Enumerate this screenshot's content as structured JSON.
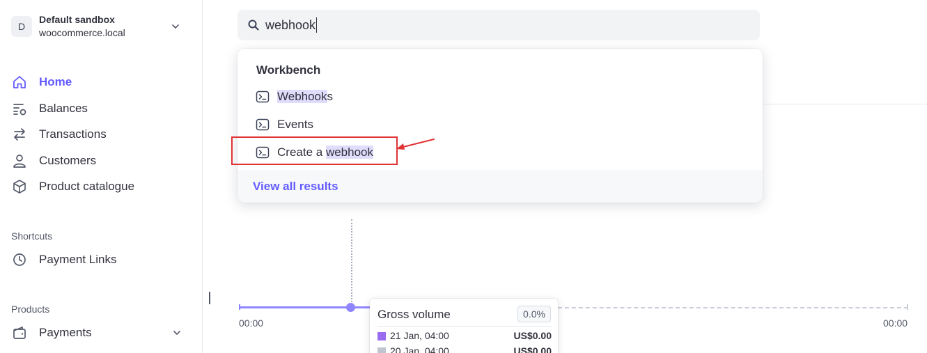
{
  "account": {
    "avatar_letter": "D",
    "name": "Default sandbox",
    "site": "woocommerce.local"
  },
  "nav": {
    "items": [
      {
        "label": "Home",
        "icon": "home-icon",
        "active": true
      },
      {
        "label": "Balances",
        "icon": "balances-icon"
      },
      {
        "label": "Transactions",
        "icon": "transactions-icon"
      },
      {
        "label": "Customers",
        "icon": "customer-icon"
      },
      {
        "label": "Product catalogue",
        "icon": "box-icon"
      }
    ],
    "shortcuts_label": "Shortcuts",
    "shortcuts": [
      {
        "label": "Payment Links",
        "icon": "clock-icon"
      }
    ],
    "products_label": "Products",
    "products": [
      {
        "label": "Payments",
        "icon": "wallet-icon"
      }
    ]
  },
  "search": {
    "value": "webhook"
  },
  "dropdown": {
    "section_title": "Workbench",
    "items": [
      {
        "pre": "",
        "match": "Webhook",
        "post": "s",
        "icon": "terminal-icon"
      },
      {
        "pre": "Events",
        "match": "",
        "post": "",
        "icon": "terminal-icon"
      },
      {
        "pre": "Create a ",
        "match": "webhook",
        "post": "",
        "icon": "terminal-icon"
      }
    ],
    "view_all": "View all results"
  },
  "chart": {
    "x_start": "00:00",
    "x_end": "00:00",
    "tooltip": {
      "title": "Gross volume",
      "change": "0.0%",
      "rows": [
        {
          "label": "21 Jan, 04:00",
          "value": "US$0.00",
          "color": "#9a6cf0"
        },
        {
          "label": "20 Jan, 04:00",
          "value": "US$0.00",
          "color": "#c0c6d0"
        }
      ]
    }
  },
  "colors": {
    "accent": "#635bff",
    "highlight": "#e0dcfb",
    "annotation": "#e03232"
  }
}
